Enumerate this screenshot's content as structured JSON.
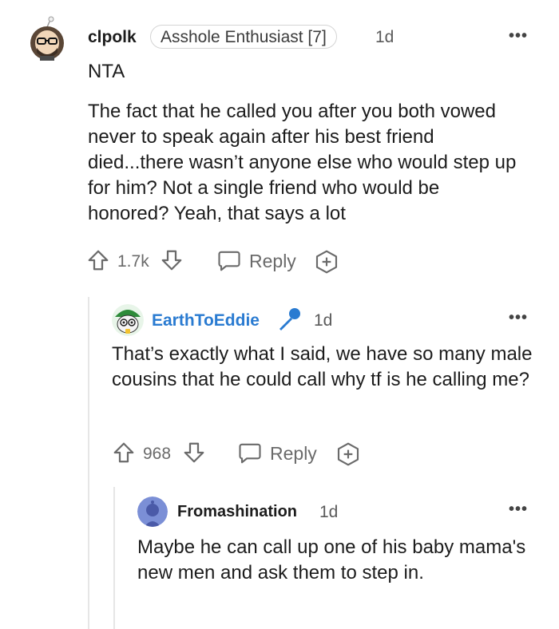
{
  "comments": [
    {
      "username": "clpolk",
      "flair": "Asshole Enthusiast [7]",
      "age": "1d",
      "verdict": "NTA",
      "body": "The fact that he called you after you both vowed never to speak again after his best friend died...there wasn’t anyone else who would step up for him? Not a single friend who would be honored? Yeah, that says a lot",
      "score": "1.7k",
      "reply_label": "Reply"
    },
    {
      "username": "EarthToEddie",
      "is_op": true,
      "age": "1d",
      "body": "That’s exactly what I said, we have so many male cousins that he could call why tf is he calling me?",
      "score": "968",
      "reply_label": "Reply"
    },
    {
      "username": "Fromashination",
      "age": "1d",
      "body": "Maybe he can call up one of his baby mama's new men and ask them to step in."
    }
  ],
  "more_glyph": "•••",
  "colors": {
    "op_blue": "#2a7bd1",
    "text": "#1c1c1c",
    "muted": "#6a6a6a",
    "thread_line": "#e6e6e6"
  }
}
